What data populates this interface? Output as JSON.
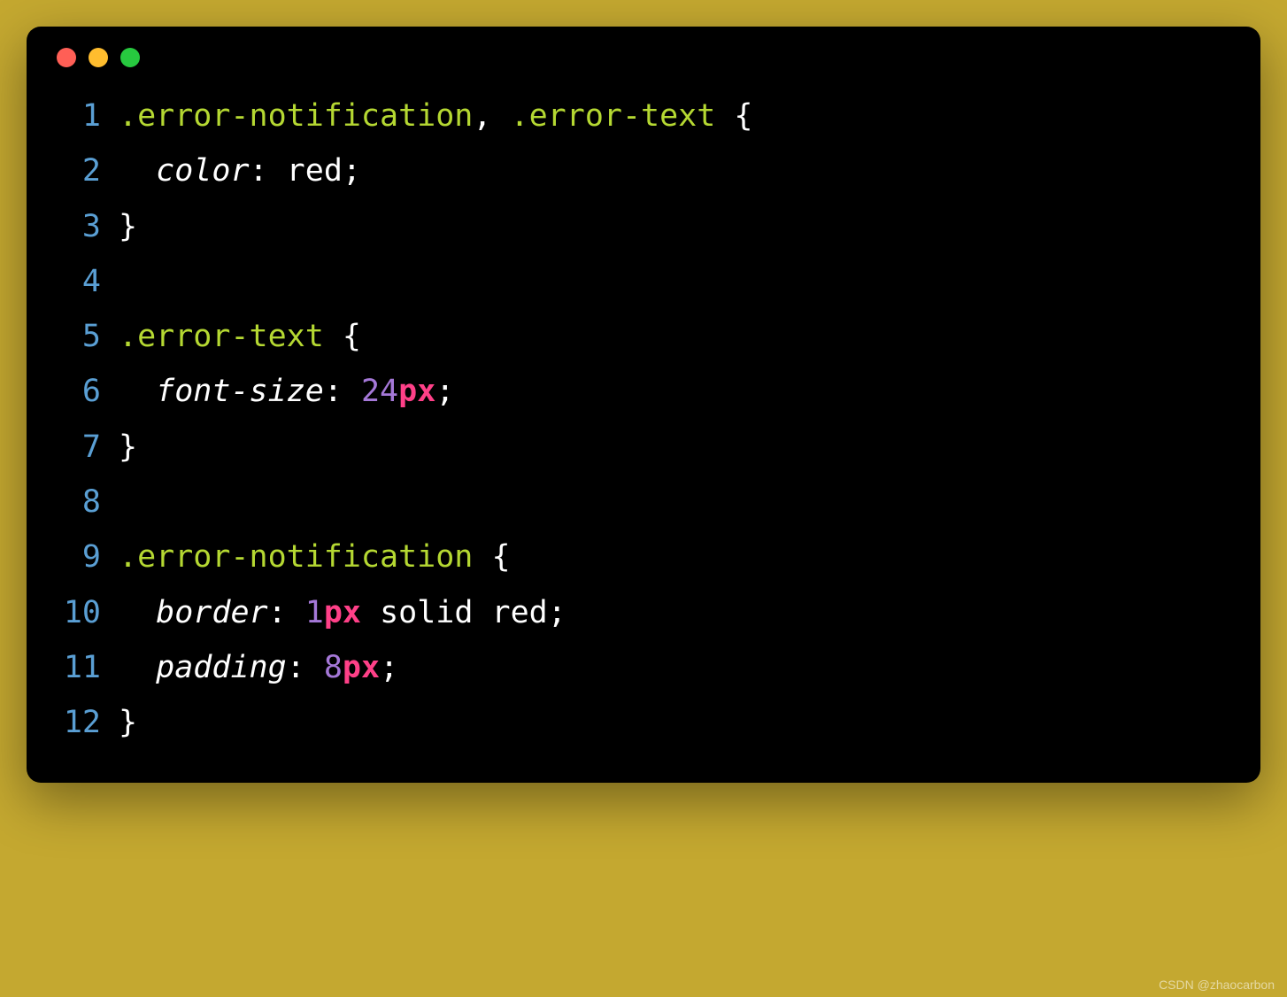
{
  "watermark": "CSDN @zhaocarbon",
  "code": {
    "lines": [
      {
        "num": "1",
        "tokens": [
          {
            "cls": "selector",
            "t": ".error-notification"
          },
          {
            "cls": "punct",
            "t": ", "
          },
          {
            "cls": "selector",
            "t": ".error-text"
          },
          {
            "cls": "punct",
            "t": " "
          },
          {
            "cls": "brace",
            "t": "{"
          }
        ]
      },
      {
        "num": "2",
        "tokens": [
          {
            "cls": "punct",
            "t": "  "
          },
          {
            "cls": "property",
            "t": "color"
          },
          {
            "cls": "punct",
            "t": ": "
          },
          {
            "cls": "value-keyword",
            "t": "red"
          },
          {
            "cls": "punct",
            "t": ";"
          }
        ]
      },
      {
        "num": "3",
        "tokens": [
          {
            "cls": "brace",
            "t": "}"
          }
        ]
      },
      {
        "num": "4",
        "tokens": []
      },
      {
        "num": "5",
        "tokens": [
          {
            "cls": "selector",
            "t": ".error-text"
          },
          {
            "cls": "punct",
            "t": " "
          },
          {
            "cls": "brace",
            "t": "{"
          }
        ]
      },
      {
        "num": "6",
        "tokens": [
          {
            "cls": "punct",
            "t": "  "
          },
          {
            "cls": "property",
            "t": "font-size"
          },
          {
            "cls": "punct",
            "t": ": "
          },
          {
            "cls": "number",
            "t": "24"
          },
          {
            "cls": "unit",
            "t": "px"
          },
          {
            "cls": "punct",
            "t": ";"
          }
        ]
      },
      {
        "num": "7",
        "tokens": [
          {
            "cls": "brace",
            "t": "}"
          }
        ]
      },
      {
        "num": "8",
        "tokens": []
      },
      {
        "num": "9",
        "tokens": [
          {
            "cls": "selector",
            "t": ".error-notification"
          },
          {
            "cls": "punct",
            "t": " "
          },
          {
            "cls": "brace",
            "t": "{"
          }
        ]
      },
      {
        "num": "10",
        "tokens": [
          {
            "cls": "punct",
            "t": "  "
          },
          {
            "cls": "property",
            "t": "border"
          },
          {
            "cls": "punct",
            "t": ": "
          },
          {
            "cls": "number",
            "t": "1"
          },
          {
            "cls": "unit",
            "t": "px"
          },
          {
            "cls": "punct",
            "t": " "
          },
          {
            "cls": "value-keyword",
            "t": "solid"
          },
          {
            "cls": "punct",
            "t": " "
          },
          {
            "cls": "value-keyword",
            "t": "red"
          },
          {
            "cls": "punct",
            "t": ";"
          }
        ]
      },
      {
        "num": "11",
        "tokens": [
          {
            "cls": "punct",
            "t": "  "
          },
          {
            "cls": "property",
            "t": "padding"
          },
          {
            "cls": "punct",
            "t": ": "
          },
          {
            "cls": "number",
            "t": "8"
          },
          {
            "cls": "unit",
            "t": "px"
          },
          {
            "cls": "punct",
            "t": ";"
          }
        ]
      },
      {
        "num": "12",
        "tokens": [
          {
            "cls": "brace",
            "t": "}"
          }
        ]
      }
    ]
  }
}
